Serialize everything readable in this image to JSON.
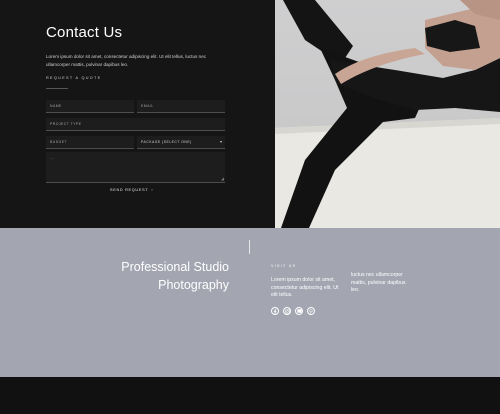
{
  "contact": {
    "heading": "Contact Us",
    "intro": "Lorem ipsum dolor sit amet, consectetur adipiscing elit. Ut elit tellus, luctus nec ullamcorper mattis, pulvinar dapibus leo.",
    "subheading": "REQUEST A QUOTE",
    "form": {
      "name_label": "NAME",
      "email_label": "EMAIL",
      "project_type_label": "PROJECT TYPE",
      "budget_label": "BUDGET",
      "package_label": "PACKAGE (SELECT ONE)",
      "message_label": "…",
      "submit_label": "SEND REQUEST",
      "submit_arrow": "›"
    }
  },
  "footer": {
    "title": "Professional Studio Photography",
    "visit_label": "VISIT US",
    "address_1": "Lorem ipsum dolor sit amet, consectetur adipiscing elit. Ut elit tellus.",
    "address_2": "luctus nec ullamcorper mattis, pulvinar dapibus leo.",
    "social_icons": [
      "facebook-icon",
      "instagram-icon",
      "twitter-icon",
      "pinterest-icon"
    ]
  },
  "colors": {
    "contact_bg": "#151515",
    "footer_bg": "#a3a5b1",
    "bottom_bar_bg": "#111111",
    "field_bg": "#1d1d1d"
  }
}
